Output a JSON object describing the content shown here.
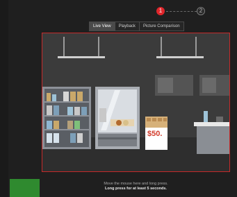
{
  "stepper": {
    "steps": [
      "1",
      "2"
    ],
    "active_step": 1
  },
  "tabs": [
    {
      "label": "Live View",
      "active": true
    },
    {
      "label": "Playback",
      "active": false
    },
    {
      "label": "Picture Comparison",
      "active": false
    }
  ],
  "preview": {
    "price_sign": "$50.",
    "border_color": "#c52a2a"
  },
  "hint": {
    "line1": "Move the mouse here and long press.",
    "line2": "Long press for at least 5 seconds."
  },
  "colors": {
    "accent_red": "#e0262b",
    "status_green": "#2f8a2f"
  }
}
